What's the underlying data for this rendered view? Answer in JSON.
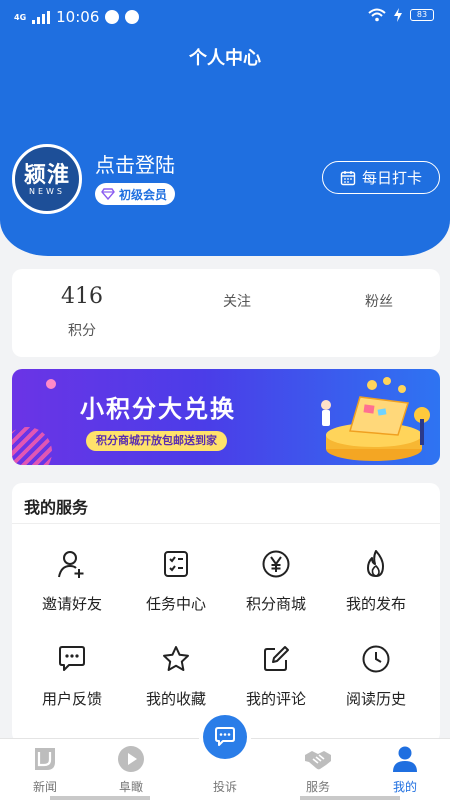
{
  "status_bar": {
    "carrier": "4G",
    "time": "10:06",
    "battery": "83"
  },
  "header": {
    "title": "个人中心"
  },
  "profile": {
    "avatar_logo_main": "颍淮",
    "avatar_logo_sub": "NEWS",
    "login_prompt": "点击登陆",
    "member_level": "初级会员",
    "checkin_label": "每日打卡"
  },
  "stats": {
    "points_value": "416",
    "points_label": "积分",
    "follow_label": "关注",
    "fans_label": "粉丝"
  },
  "banner": {
    "title": "小积分大兑换",
    "subtitle": "积分商城开放包邮送到家"
  },
  "services": {
    "title": "我的服务",
    "items": [
      {
        "label": "邀请好友",
        "icon": "add-user-icon"
      },
      {
        "label": "任务中心",
        "icon": "task-list-icon"
      },
      {
        "label": "积分商城",
        "icon": "yen-icon"
      },
      {
        "label": "我的发布",
        "icon": "flame-icon"
      },
      {
        "label": "用户反馈",
        "icon": "feedback-icon"
      },
      {
        "label": "我的收藏",
        "icon": "star-icon"
      },
      {
        "label": "我的评论",
        "icon": "edit-icon"
      },
      {
        "label": "阅读历史",
        "icon": "clock-icon"
      }
    ]
  },
  "tabbar": {
    "items": [
      {
        "label": "新闻",
        "icon": "news-icon"
      },
      {
        "label": "阜瞰",
        "icon": "play-icon"
      },
      {
        "label": "投诉",
        "icon": "chat-icon"
      },
      {
        "label": "服务",
        "icon": "handshake-icon"
      },
      {
        "label": "我的",
        "icon": "user-icon",
        "active": true
      }
    ]
  },
  "colors": {
    "primary": "#1f6fe0",
    "background": "#f2f3f5",
    "card": "#ffffff"
  }
}
